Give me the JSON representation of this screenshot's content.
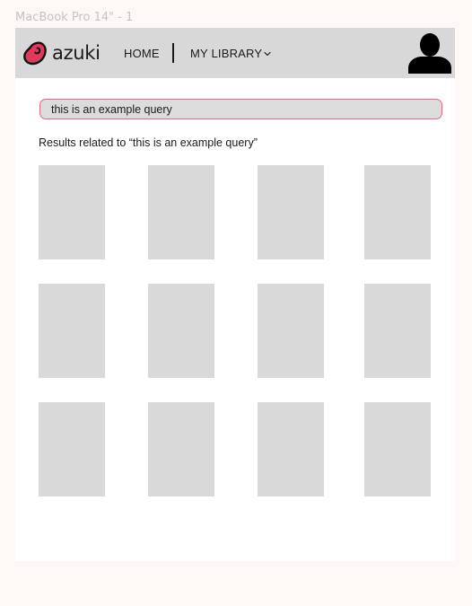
{
  "frame": {
    "label": "MacBook Pro 14\" - 1"
  },
  "brand": {
    "name": "azuki",
    "accent_color": "#e03a5a"
  },
  "nav": {
    "home_label": "HOME",
    "library_label": "MY LIBRARY"
  },
  "search": {
    "value": "this is an example query"
  },
  "results": {
    "heading": "Results related to “this is an example query”",
    "count": 12
  }
}
